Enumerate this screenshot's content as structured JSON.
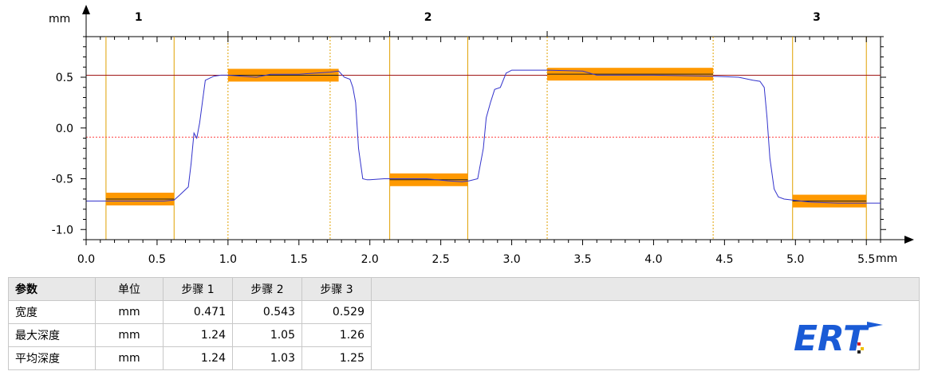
{
  "chart_data": {
    "type": "line",
    "x_unit": "mm",
    "y_unit": "mm",
    "xlim": [
      0.0,
      5.6
    ],
    "ylim": [
      -1.1,
      0.9
    ],
    "x_ticks": [
      "0.0",
      "0.5",
      "1.0",
      "1.5",
      "2.0",
      "2.5",
      "3.0",
      "3.5",
      "4.0",
      "4.5",
      "5.0",
      "5.5"
    ],
    "y_ticks": [
      "-1.0",
      "-0.5",
      "0.0",
      "0.5"
    ],
    "reference_line": 0.52,
    "reference_dotted": -0.09,
    "step_labels": [
      "1",
      "2",
      "3"
    ],
    "step_label_x": [
      0.37,
      2.41,
      5.15
    ],
    "step_separators": [
      1.0,
      2.14,
      3.25
    ],
    "sections": [
      {
        "x0": 0.14,
        "x1": 0.62,
        "style": "solid"
      },
      {
        "x0": 1.0,
        "x1": 1.72,
        "style": "dotted"
      },
      {
        "x0": 2.14,
        "x1": 2.69,
        "style": "solid"
      },
      {
        "x0": 3.25,
        "x1": 4.42,
        "style": "dotted"
      },
      {
        "x0": 4.98,
        "x1": 5.5,
        "style": "solid"
      }
    ],
    "fit_bars": [
      {
        "x0": 0.14,
        "x1": 0.62,
        "y": -0.7
      },
      {
        "x0": 1.0,
        "x1": 1.78,
        "y": 0.52
      },
      {
        "x0": 2.14,
        "x1": 2.69,
        "y": -0.51
      },
      {
        "x0": 3.25,
        "x1": 4.42,
        "y": 0.53
      },
      {
        "x0": 4.98,
        "x1": 5.5,
        "y": -0.72
      }
    ],
    "series": [
      {
        "color": "#3333cc",
        "x": [
          0.0,
          0.3,
          0.55,
          0.62,
          0.66,
          0.72,
          0.74,
          0.76,
          0.78,
          0.8,
          0.84,
          0.9,
          0.95,
          1.0,
          1.1,
          1.2,
          1.3,
          1.5,
          1.72,
          1.78,
          1.82,
          1.86,
          1.88,
          1.9,
          1.92,
          1.95,
          1.98,
          2.0,
          2.1,
          2.2,
          2.4,
          2.55,
          2.65,
          2.7,
          2.76,
          2.8,
          2.82,
          2.85,
          2.88,
          2.92,
          2.96,
          3.0,
          3.1,
          3.25,
          3.5,
          3.6,
          4.0,
          4.42,
          4.6,
          4.7,
          4.75,
          4.78,
          4.8,
          4.82,
          4.85,
          4.88,
          4.92,
          4.98,
          5.1,
          5.3,
          5.5,
          5.6
        ],
        "y": [
          -0.72,
          -0.72,
          -0.72,
          -0.71,
          -0.66,
          -0.58,
          -0.35,
          -0.05,
          -0.1,
          0.05,
          0.47,
          0.51,
          0.52,
          0.52,
          0.51,
          0.5,
          0.53,
          0.53,
          0.55,
          0.56,
          0.5,
          0.48,
          0.4,
          0.25,
          -0.2,
          -0.5,
          -0.51,
          -0.51,
          -0.5,
          -0.5,
          -0.5,
          -0.52,
          -0.53,
          -0.52,
          -0.5,
          -0.2,
          0.1,
          0.25,
          0.38,
          0.4,
          0.54,
          0.57,
          0.57,
          0.57,
          0.56,
          0.52,
          0.52,
          0.51,
          0.5,
          0.47,
          0.46,
          0.4,
          0.1,
          -0.3,
          -0.6,
          -0.68,
          -0.7,
          -0.71,
          -0.73,
          -0.74,
          -0.74,
          -0.74
        ]
      }
    ]
  },
  "table": {
    "headers": [
      "参数",
      "单位",
      "步骤 1",
      "步骤 2",
      "步骤 3"
    ],
    "rows": [
      [
        "宽度",
        "mm",
        "0.471",
        "0.543",
        "0.529"
      ],
      [
        "最大深度",
        "mm",
        "1.24",
        "1.05",
        "1.26"
      ],
      [
        "平均深度",
        "mm",
        "1.24",
        "1.03",
        "1.25"
      ]
    ]
  },
  "logo": {
    "text": "ERT",
    "color": "#1a5bd6"
  }
}
